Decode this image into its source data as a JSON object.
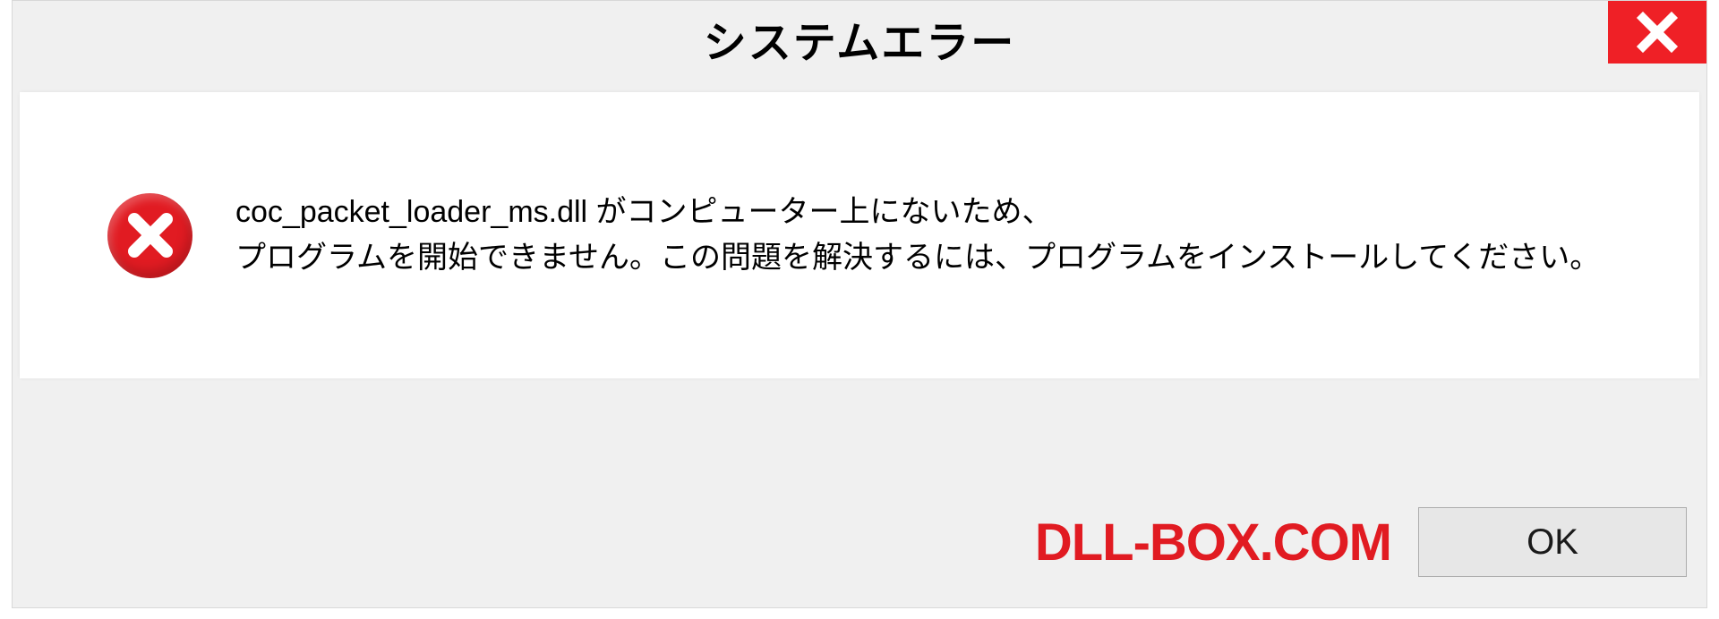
{
  "dialog": {
    "title": "システムエラー",
    "message": "coc_packet_loader_ms.dll がコンピューター上にないため、\nプログラムを開始できません。この問題を解決するには、プログラムをインストールしてください。",
    "ok_label": "OK"
  },
  "brand": {
    "name": "DLL-BOX.COM"
  },
  "colors": {
    "accent_red": "#e11b22",
    "close_red": "#ef2026",
    "dialog_bg": "#f0f0f0",
    "content_bg": "#ffffff",
    "button_bg": "#e7e7e7"
  }
}
